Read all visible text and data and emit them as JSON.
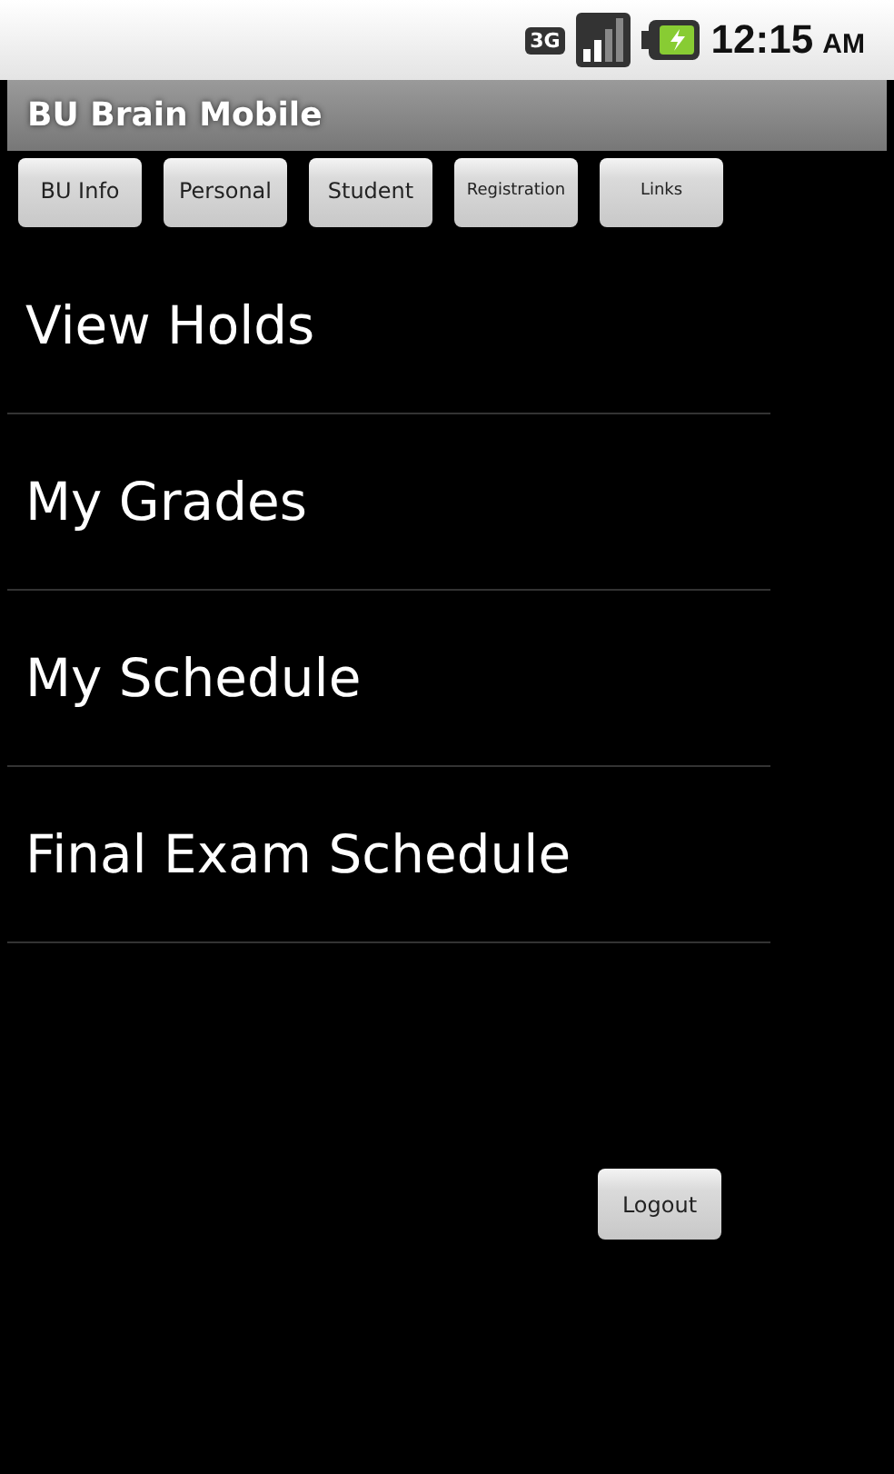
{
  "status_bar": {
    "network": "3G",
    "time": "12:15",
    "meridiem": "AM"
  },
  "title": "BU Brain Mobile",
  "tabs": [
    {
      "label": "BU Info",
      "kind": "normal"
    },
    {
      "label": "Personal",
      "kind": "normal"
    },
    {
      "label": "Student",
      "kind": "normal"
    },
    {
      "label": "Registration",
      "kind": "small"
    },
    {
      "label": "Links",
      "kind": "small"
    }
  ],
  "menu": [
    "View Holds",
    "My Grades",
    "My Schedule",
    "Final Exam Schedule"
  ],
  "logout": "Logout"
}
